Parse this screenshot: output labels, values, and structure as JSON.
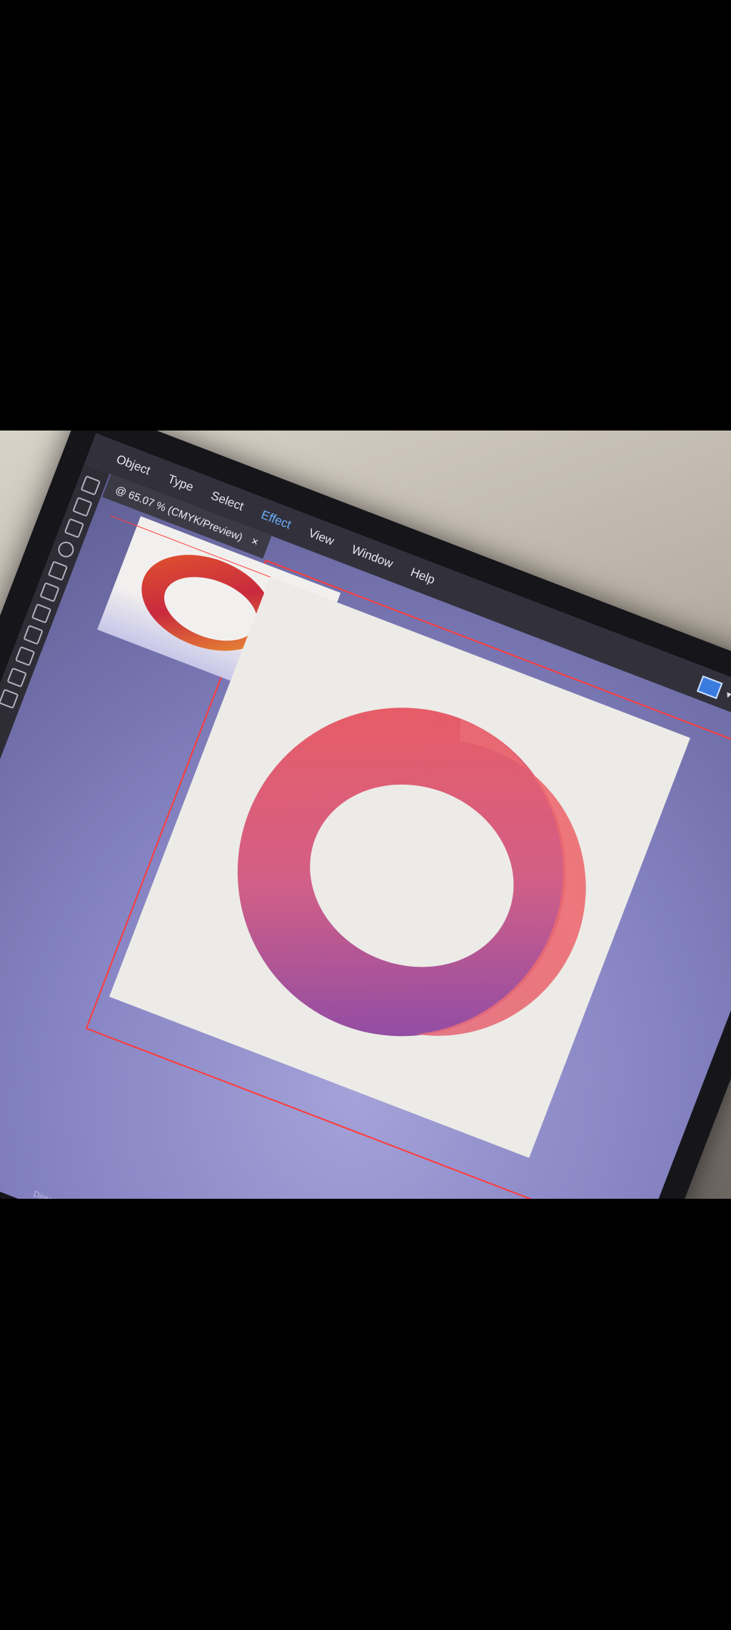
{
  "menu": {
    "items": [
      {
        "label": "Object",
        "active": false
      },
      {
        "label": "Type",
        "active": false
      },
      {
        "label": "Select",
        "active": false
      },
      {
        "label": "Effect",
        "active": true
      },
      {
        "label": "View",
        "active": false
      },
      {
        "label": "Window",
        "active": false
      },
      {
        "label": "Help",
        "active": false
      }
    ]
  },
  "document_tab": {
    "title": "@ 65.07 % (CMYK/Preview)",
    "close_label": "×"
  },
  "status": {
    "tool_name": "Direct Selection"
  },
  "colors": {
    "accent": "#6ab0ff",
    "guide_red": "#ff3b3b",
    "ring_top": "#e95a5e",
    "ring_bottom": "#9a4e9e"
  },
  "icons": [
    "direct-selection-icon",
    "pen-icon",
    "type-icon",
    "ellipse-icon",
    "rotate-icon",
    "brush-icon",
    "eraser-icon",
    "rectangle-icon",
    "eyedropper-icon",
    "zoom-icon",
    "hand-icon"
  ]
}
